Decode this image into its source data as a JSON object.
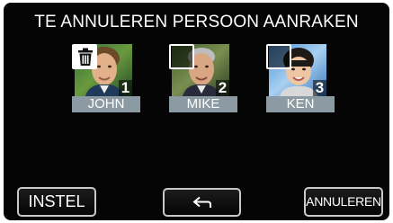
{
  "screen": {
    "title": "TE ANNULEREN PERSOON AANRAKEN"
  },
  "persons": [
    {
      "name": "JOHN",
      "number": "1",
      "selected": true,
      "checkbox_icon": "trash-icon"
    },
    {
      "name": "MIKE",
      "number": "2",
      "selected": false
    },
    {
      "name": "KEN",
      "number": "3",
      "selected": false
    }
  ],
  "buttons": {
    "instel": "INSTEL",
    "back_icon": "return-arrow-icon",
    "annuleren": "ANNULEREN"
  },
  "colors": {
    "background": "#050505",
    "name_bar": "#8c9aa3",
    "text": "#ffffff",
    "button_border": "#c9c9c9"
  }
}
